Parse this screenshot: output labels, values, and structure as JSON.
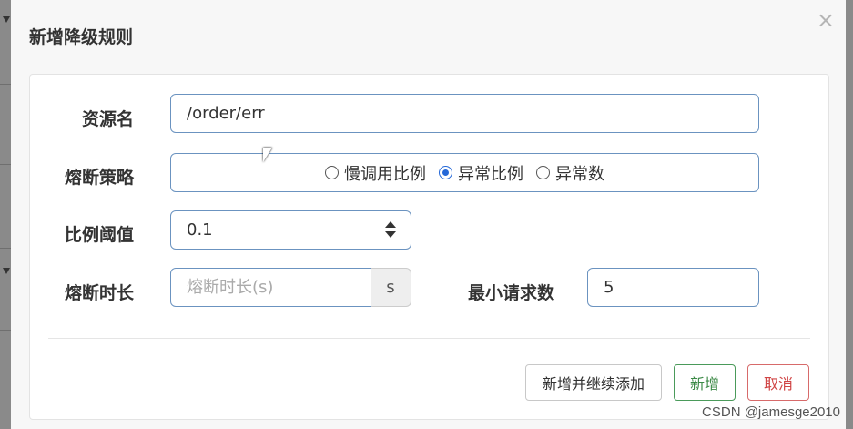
{
  "dialog": {
    "title": "新增降级规则",
    "close_symbol": "×"
  },
  "form": {
    "resource_name": {
      "label": "资源名",
      "value": "/order/err"
    },
    "strategy": {
      "label": "熔断策略",
      "options": [
        {
          "label": "慢调用比例",
          "checked": false
        },
        {
          "label": "异常比例",
          "checked": true
        },
        {
          "label": "异常数",
          "checked": false
        }
      ]
    },
    "ratio_threshold": {
      "label": "比例阈值",
      "value": "0.1"
    },
    "break_duration": {
      "label": "熔断时长",
      "placeholder": "熔断时长(s)",
      "unit": "s"
    },
    "min_requests": {
      "label": "最小请求数",
      "value": "5"
    }
  },
  "buttons": {
    "add_continue": "新增并继续添加",
    "add": "新增",
    "cancel": "取消"
  },
  "watermark": "CSDN @jamesge2010",
  "colors": {
    "accent": "#2468d8",
    "add_button": "#3c8a47",
    "cancel_button": "#d04545"
  }
}
